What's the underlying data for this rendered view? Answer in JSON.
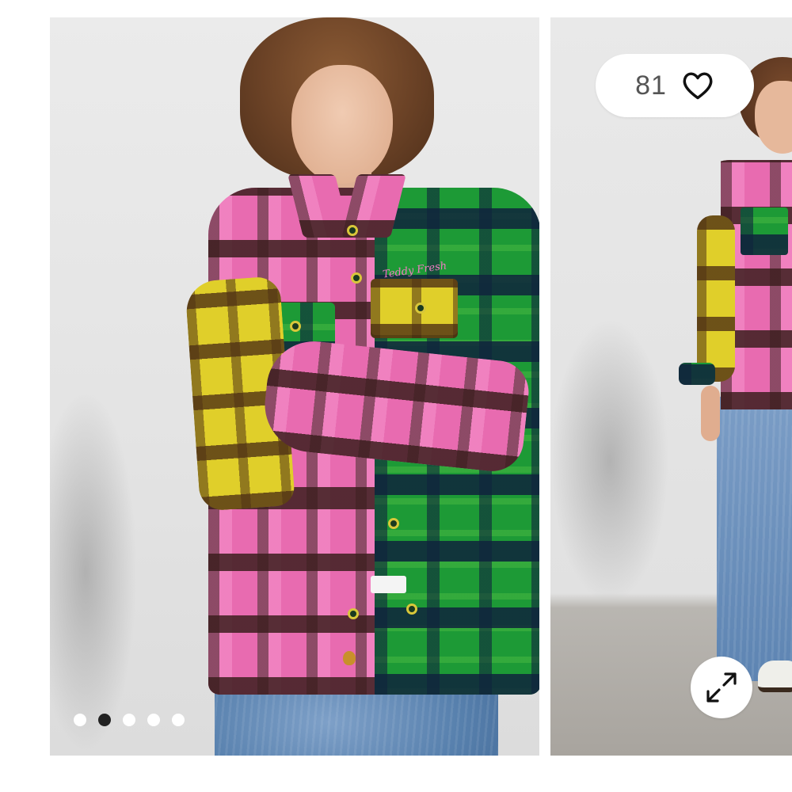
{
  "gallery": {
    "like_count": "81",
    "icons": {
      "like": "heart-outline-icon",
      "expand": "expand-arrows-icon"
    },
    "pagination": {
      "total": 5,
      "active_index": 1
    },
    "images": [
      {
        "subject": "model-wearing-multicolor-plaid-shirt-jacket-arms-crossed"
      },
      {
        "subject": "model-wearing-multicolor-plaid-shirt-jacket-full-length"
      }
    ],
    "colors": {
      "accent_dot": "#222222",
      "inactive_dot": "#ffffff",
      "overlay_bg": "#ffffff",
      "like_text": "#555555"
    }
  }
}
